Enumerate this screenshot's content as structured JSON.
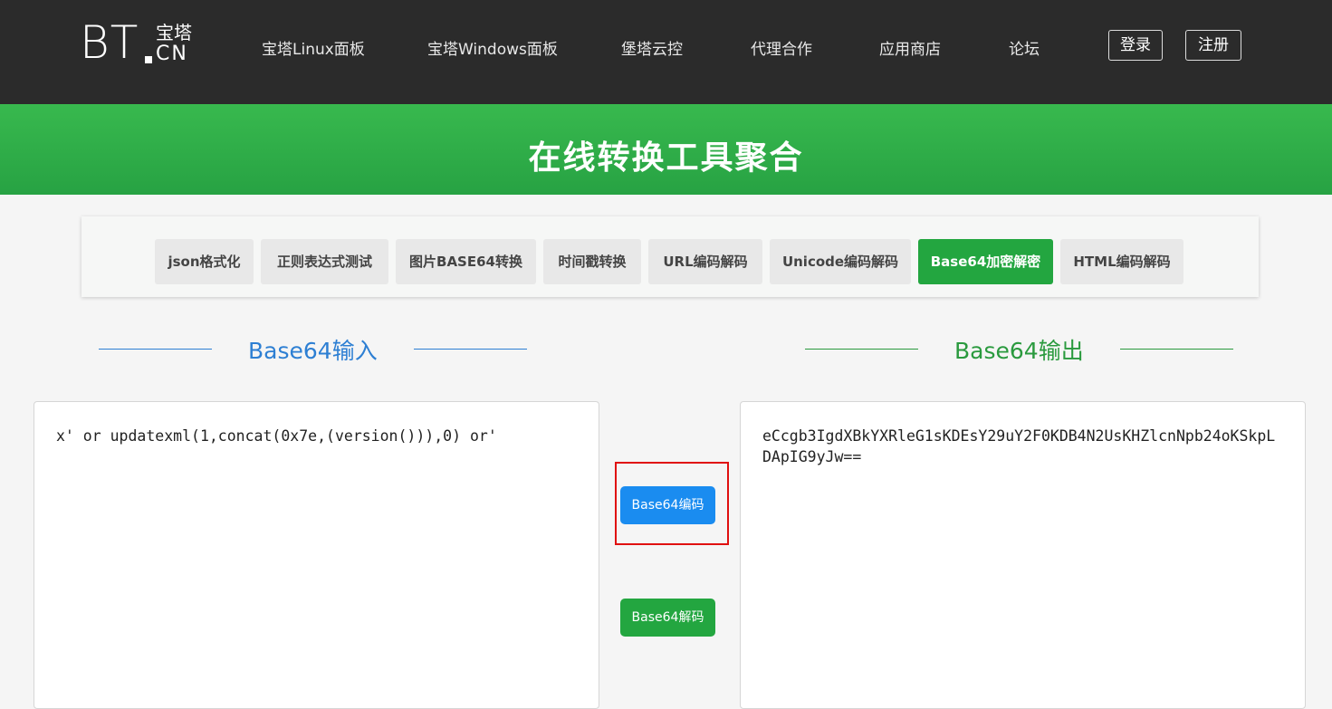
{
  "header": {
    "logo": {
      "bt": "BT",
      "cn_top": "宝塔",
      "cn_bottom": "CN"
    },
    "nav": [
      "宝塔Linux面板",
      "宝塔Windows面板",
      "堡塔云控",
      "代理合作",
      "应用商店",
      "论坛"
    ],
    "login": "登录",
    "register": "注册"
  },
  "banner": {
    "title": "在线转换工具聚合"
  },
  "tabs": [
    {
      "label": "json格式化",
      "active": false
    },
    {
      "label": "正则表达式测试",
      "active": false
    },
    {
      "label": "图片BASE64转换",
      "active": false
    },
    {
      "label": "时间戳转换",
      "active": false
    },
    {
      "label": "URL编码解码",
      "active": false
    },
    {
      "label": "Unicode编码解码",
      "active": false
    },
    {
      "label": "Base64加密解密",
      "active": true
    },
    {
      "label": "HTML编码解码",
      "active": false
    }
  ],
  "input_section": {
    "title": "Base64输入",
    "color": "#2d7fd3",
    "value": "x' or updatexml(1,concat(0x7e,(version())),0) or'"
  },
  "output_section": {
    "title": "Base64输出",
    "color": "#2a9a3e",
    "value": "eCcgb3IgdXBkYXRleG1sKDEsY29uY2F0KDB4N2UsKHZlcnNpb24oKSkpLDApIG9yJw=="
  },
  "buttons": {
    "encode": "Base64编码",
    "decode": "Base64解码"
  },
  "colors": {
    "encode_button": "#1a8cf0",
    "decode_button": "#23a640",
    "highlight": "#e01010"
  }
}
